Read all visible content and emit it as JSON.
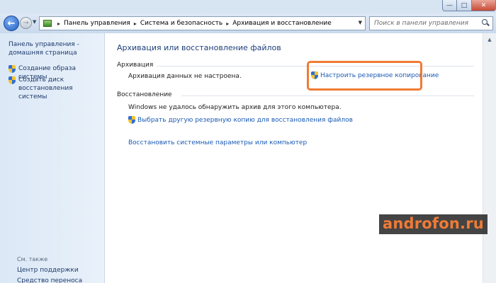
{
  "window": {
    "minimize_glyph": "—",
    "maximize_glyph": "□",
    "close_glyph": "✕"
  },
  "nav": {
    "back_glyph": "←",
    "forward_glyph": "→",
    "history_glyph": "▼",
    "refresh_glyph": "↻",
    "dropdown_glyph": "▼",
    "sep_glyph": "▸",
    "breadcrumbs": [
      "Панель управления",
      "Система и безопасность",
      "Архивация и восстановление"
    ]
  },
  "search": {
    "placeholder": "Поиск в панели управления"
  },
  "sidebar": {
    "home": "Панель управления - домашняя страница",
    "tasks": [
      {
        "label": "Создание образа системы"
      },
      {
        "label": "Создать диск восстановления системы"
      }
    ],
    "see_also_title": "См. также",
    "see_also": [
      {
        "label": "Центр поддержки"
      },
      {
        "label": "Средство переноса данных"
      }
    ]
  },
  "main": {
    "title": "Архивация или восстановление файлов",
    "backup": {
      "heading": "Архивация",
      "status": "Архивация данных не настроена.",
      "setup_link": "Настроить резервное копирование"
    },
    "restore": {
      "heading": "Восстановление",
      "status": "Windows не удалось обнаружить архив для этого компьютера.",
      "select_link": "Выбрать другую резервную копию для восстановления файлов",
      "system_link": "Восстановить системные параметры или компьютер"
    }
  },
  "watermark": "androfon.ru",
  "colors": {
    "highlight": "#f07b35",
    "link": "#1a5bb4",
    "title": "#1e3f7a"
  }
}
